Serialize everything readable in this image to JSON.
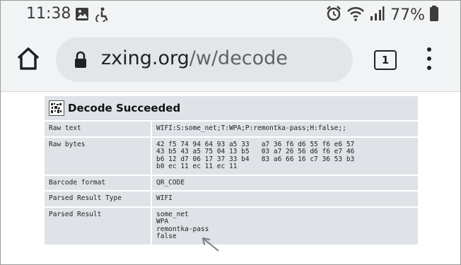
{
  "status_bar": {
    "time": "11:38",
    "battery": "77%",
    "icons_left": [
      "image-icon",
      "accessibility-icon"
    ],
    "icons_right": [
      "alarm-icon",
      "wifi-icon",
      "signal-icon",
      "battery-icon"
    ]
  },
  "browser": {
    "url_domain": "zxing.org",
    "url_path": "/w/decode",
    "tab_count": "1"
  },
  "result": {
    "title": "Decode Succeeded",
    "rows": [
      {
        "label": "Raw text",
        "value": "WIFI:S:some_net;T:WPA;P:remontka-pass;H:false;;"
      },
      {
        "label": "Raw bytes",
        "value": "42 f5 74 94 64 93 a5 33   a7 36 f6 d6 55 f6 e6 57\n43 b5 43 a5 75 04 13 b5   03 a7 26 56 d6 f6 e7 46\nb6 12 d7 06 17 37 33 b4   83 a6 66 16 c7 36 53 b3\nb0 ec 11 ec 11 ec 11"
      },
      {
        "label": "Barcode format",
        "value": "QR_CODE"
      },
      {
        "label": "Parsed Result Type",
        "value": "WIFI"
      },
      {
        "label": "Parsed Result",
        "value": "some_net\nWPA\nremontka-pass\nfalse"
      }
    ]
  },
  "colors": {
    "chrome_bg": "#f1f3f4",
    "url_bar_bg": "#e3e5e8",
    "cell_bg": "#dfe3e7",
    "arrow": "#7a7f85"
  }
}
